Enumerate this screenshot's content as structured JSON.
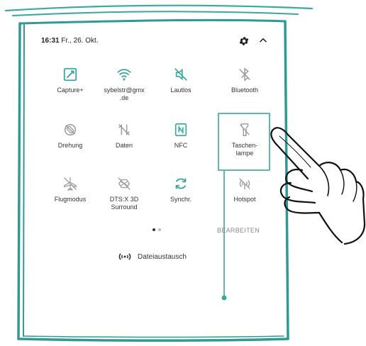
{
  "status": {
    "time": "16:31",
    "date": "Fr., 26. Okt."
  },
  "tiles": [
    {
      "label": "Capture+",
      "icon": "capture-icon"
    },
    {
      "label": "sybelstr@gmx\n.de",
      "icon": "wifi-icon"
    },
    {
      "label": "Lautlos",
      "icon": "mute-icon"
    },
    {
      "label": "Bluetooth",
      "icon": "bluetooth-off-icon"
    },
    {
      "label": "Drehung",
      "icon": "rotation-off-icon"
    },
    {
      "label": "Daten",
      "icon": "data-off-icon"
    },
    {
      "label": "NFC",
      "icon": "nfc-icon"
    },
    {
      "label": "Taschen-\nlampe",
      "icon": "flashlight-off-icon"
    },
    {
      "label": "Flugmodus",
      "icon": "airplane-off-icon"
    },
    {
      "label": "DTS:X 3D\nSurround",
      "icon": "dts-off-icon"
    },
    {
      "label": "Synchr.",
      "icon": "sync-icon"
    },
    {
      "label": "Hotspot",
      "icon": "hotspot-off-icon"
    }
  ],
  "edit_label": "BEARBEITEN",
  "share_label": "Dateiaustausch",
  "colors": {
    "accent": "#3aa7a0",
    "frame": "#2f9a94",
    "icon_gray": "#9a9a9a"
  }
}
